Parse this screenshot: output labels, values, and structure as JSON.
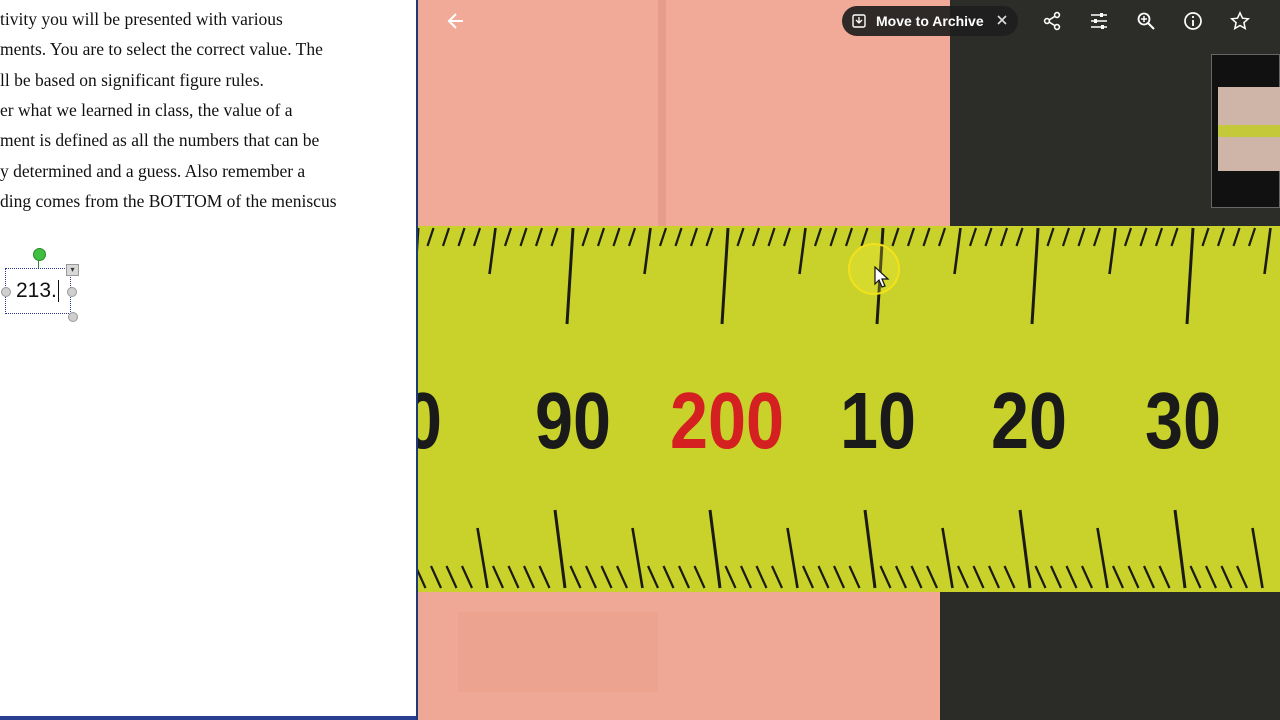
{
  "document": {
    "lines": [
      "tivity you will be presented with various",
      "ments. You are to select the correct value. The",
      "ll be based on significant figure rules.",
      "er what we learned in class, the value of a",
      "ment is defined as all the numbers that can be",
      "y determined and a guess. Also remember a",
      "ding comes from the BOTTOM of the meniscus"
    ],
    "textbox_value": "213."
  },
  "viewer": {
    "toolbar": {
      "back_icon": "arrow-left-icon",
      "archive_label": "Move to Archive",
      "archive_icon": "archive-icon",
      "dismiss_icon": "close-icon",
      "share_icon": "share-icon",
      "edit_icon": "sliders-icon",
      "zoom_icon": "zoom-in-icon",
      "info_icon": "info-icon",
      "favorite_icon": "star-icon"
    },
    "ruler_labels": [
      {
        "text": "0",
        "color": "#1a1a1a"
      },
      {
        "text": "90",
        "color": "#1a1a1a"
      },
      {
        "text": "200",
        "color": "#d42020"
      },
      {
        "text": "10",
        "color": "#1a1a1a"
      },
      {
        "text": "20",
        "color": "#1a1a1a"
      },
      {
        "text": "30",
        "color": "#1a1a1a"
      }
    ]
  },
  "colors": {
    "tape": "#c8d22a",
    "pink_card": "#f2aa98",
    "highlight_ring": "#f3e21a",
    "red_label": "#d42020",
    "selection_border": "#2a3a9a"
  }
}
